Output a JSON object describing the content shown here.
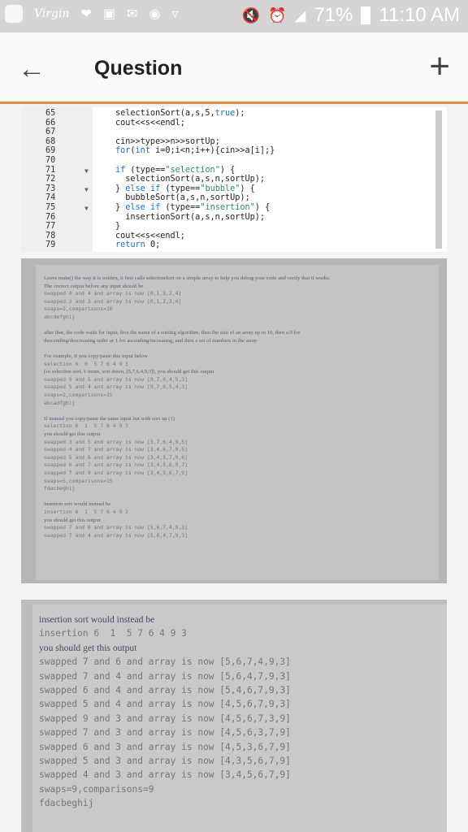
{
  "status_bar": {
    "battery": "71%",
    "time": "11:10 AM",
    "carrier_logo": "Virgin"
  },
  "app_bar": {
    "title": "Question",
    "back_icon": "arrow-left",
    "add_icon": "plus"
  },
  "code": {
    "lines": [
      {
        "n": "65",
        "fold": "",
        "text": "selectionSort(a,s,5,true);"
      },
      {
        "n": "66",
        "fold": "",
        "text": "cout<<s<<endl;"
      },
      {
        "n": "67",
        "fold": "",
        "text": ""
      },
      {
        "n": "68",
        "fold": "",
        "text": "cin>>type>>n>>sortUp;"
      },
      {
        "n": "69",
        "fold": "",
        "text": "for(int i=0;i<n;i++){cin>>a[i];}"
      },
      {
        "n": "70",
        "fold": "",
        "text": ""
      },
      {
        "n": "71",
        "fold": "▼",
        "text": "if (type==\"selection\") {"
      },
      {
        "n": "72",
        "fold": "",
        "text": "  selectionSort(a,s,n,sortUp);"
      },
      {
        "n": "73",
        "fold": "▼",
        "text": "} else if (type==\"bubble\") {"
      },
      {
        "n": "74",
        "fold": "",
        "text": "  bubbleSort(a,s,n,sortUp);"
      },
      {
        "n": "75",
        "fold": "▼",
        "text": "} else if (type==\"insertion\") {"
      },
      {
        "n": "76",
        "fold": "",
        "text": "  insertionSort(a,s,n,sortUp);"
      },
      {
        "n": "77",
        "fold": "",
        "text": "}"
      },
      {
        "n": "78",
        "fold": "",
        "text": "cout<<s<<endl;"
      },
      {
        "n": "79",
        "fold": "",
        "text": "return 0;"
      }
    ]
  },
  "photo1": {
    "lines": [
      {
        "t": "Leave main() the way it is written, it first calls selectionSort on a simple array to help you debug your code and verify that it works.",
        "mono": false
      },
      {
        "t": "The correct output before any input should be",
        "mono": false
      },
      {
        "t": "swapped 0 and 4 and array is now [0,1,3,2,4]",
        "mono": true
      },
      {
        "t": "swapped 2 and 3 and array is now [0,1,2,3,4]",
        "mono": true
      },
      {
        "t": "swaps=2,comparisons=10",
        "mono": true
      },
      {
        "t": "abcdefghij",
        "mono": true
      },
      {
        "t": "",
        "mono": false
      },
      {
        "t": "after that, the code waits for input, first the name of a sorting algorithm, then the size of an array up to 10, then a 0 for",
        "mono": false
      },
      {
        "t": "descending/descreasing order or 1 for ascending/increasing, and then a set of numbers in the array",
        "mono": false
      },
      {
        "t": "",
        "mono": false
      },
      {
        "t": "For example, if you copy/paste this input below",
        "mono": false
      },
      {
        "t": "selection 6  0  5 7 6 4 9 3",
        "mono": true
      },
      {
        "t": "(so selection sort, 6 items, sort down, [5,7,6,4,9,3]), you should get this output",
        "mono": false
      },
      {
        "t": "swapped 9 and 5 and array is now [9,7,6,4,5,3]",
        "mono": true
      },
      {
        "t": "swapped 5 and 4 and array is now [9,7,6,5,4,3]",
        "mono": true
      },
      {
        "t": "swaps=2,comparisons=15",
        "mono": true
      },
      {
        "t": "abcadfghij",
        "mono": true
      },
      {
        "t": "",
        "mono": false
      },
      {
        "t": "If instead you copy/paste the same input but with sort up (1)",
        "mono": false
      },
      {
        "t": "selection 6  1  5 7 6 4 9 3",
        "mono": true
      },
      {
        "t": "you should get this output",
        "mono": false
      },
      {
        "t": "swapped 3 and 5 and array is now [3,7,6,4,9,5]",
        "mono": true
      },
      {
        "t": "swapped 4 and 7 and array is now [3,4,6,7,9,5]",
        "mono": true
      },
      {
        "t": "swapped 5 and 6 and array is now [3,4,5,7,9,6]",
        "mono": true
      },
      {
        "t": "swapped 6 and 7 and array is now [3,4,5,6,9,7]",
        "mono": true
      },
      {
        "t": "swapped 7 and 9 and array is now [3,4,5,6,7,9]",
        "mono": true
      },
      {
        "t": "swaps=5,comparisons=15",
        "mono": true
      },
      {
        "t": "fdacbeghij",
        "mono": true
      },
      {
        "t": "",
        "mono": false
      },
      {
        "t": "insertion sort would instead be",
        "mono": false
      },
      {
        "t": "insertion 6  1  5 7 6 4 9 3",
        "mono": true
      },
      {
        "t": "you should get this output",
        "mono": false
      },
      {
        "t": "swapped 7 and 6 and array is now [5,6,7,4,9,3]",
        "mono": true
      },
      {
        "t": "swapped 7 and 4 and array is now [5,6,4,7,9,3]",
        "mono": true
      }
    ]
  },
  "photo2": {
    "lines": [
      {
        "t": "insertion sort would instead be",
        "mono": false
      },
      {
        "t": "insertion 6  1  5 7 6 4 9 3",
        "mono": true
      },
      {
        "t": "you should get this output",
        "mono": false
      },
      {
        "t": "swapped 7 and 6 and array is now [5,6,7,4,9,3]",
        "mono": true
      },
      {
        "t": "swapped 7 and 4 and array is now [5,6,4,7,9,3]",
        "mono": true
      },
      {
        "t": "swapped 6 and 4 and array is now [5,4,6,7,9,3]",
        "mono": true
      },
      {
        "t": "swapped 5 and 4 and array is now [4,5,6,7,9,3]",
        "mono": true
      },
      {
        "t": "swapped 9 and 3 and array is now [4,5,6,7,3,9]",
        "mono": true
      },
      {
        "t": "swapped 7 and 3 and array is now [4,5,6,3,7,9]",
        "mono": true
      },
      {
        "t": "swapped 6 and 3 and array is now [4,5,3,6,7,9]",
        "mono": true
      },
      {
        "t": "swapped 5 and 3 and array is now [4,3,5,6,7,9]",
        "mono": true
      },
      {
        "t": "swapped 4 and 3 and array is now [3,4,5,6,7,9]",
        "mono": true
      },
      {
        "t": "swaps=9,comparisons=9",
        "mono": true
      },
      {
        "t": "fdacbeghij",
        "mono": true
      }
    ]
  },
  "colors": {
    "accent": "#f08a3a",
    "status_bar": "#d5d5d5",
    "keyword": "#1a6fc9",
    "string": "#2e8b57"
  }
}
